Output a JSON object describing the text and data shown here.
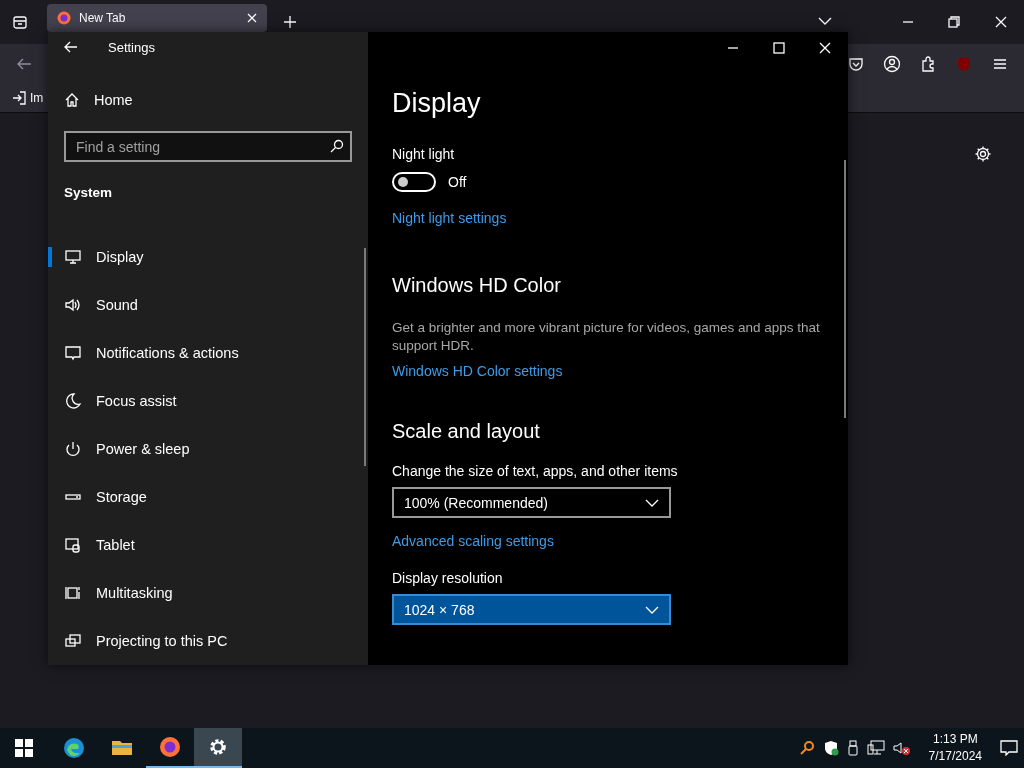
{
  "browser": {
    "tab": {
      "title": "New Tab",
      "selected": true
    },
    "bookmark": "Im"
  },
  "settings": {
    "title": "Settings",
    "home": "Home",
    "search": {
      "placeholder": "Find a setting"
    },
    "group": "System",
    "nav": [
      {
        "label": "Display",
        "kind": "display",
        "selected": true
      },
      {
        "label": "Sound",
        "kind": "sound",
        "selected": false
      },
      {
        "label": "Notifications & actions",
        "kind": "notify",
        "selected": false
      },
      {
        "label": "Focus assist",
        "kind": "moon",
        "selected": false
      },
      {
        "label": "Power & sleep",
        "kind": "power",
        "selected": false
      },
      {
        "label": "Storage",
        "kind": "storage",
        "selected": false
      },
      {
        "label": "Tablet",
        "kind": "tablet",
        "selected": false
      },
      {
        "label": "Multitasking",
        "kind": "multi",
        "selected": false
      },
      {
        "label": "Projecting to this PC",
        "kind": "project",
        "selected": false
      }
    ],
    "page": {
      "title": "Display",
      "night_light": {
        "label": "Night light",
        "on": false,
        "state": "Off",
        "link": "Night light settings"
      },
      "hd_color": {
        "heading": "Windows HD Color",
        "description": "Get a brighter and more vibrant picture for videos, games and apps that support HDR.",
        "link": "Windows HD Color settings"
      },
      "scale": {
        "heading": "Scale and layout",
        "size_label": "Change the size of text, apps, and other items",
        "size_value": "100% (Recommended)",
        "link": "Advanced scaling settings",
        "resolution_label": "Display resolution",
        "resolution_value": "1024 × 768",
        "resolution_focused": true
      }
    }
  },
  "taskbar": {
    "apps": [
      {
        "kind": "edge",
        "running": false,
        "selected": false
      },
      {
        "kind": "folder",
        "running": false,
        "selected": false
      },
      {
        "kind": "firefox",
        "running": true,
        "selected": false
      },
      {
        "kind": "gear",
        "running": true,
        "selected": true
      }
    ],
    "time": "1:13 PM",
    "date": "7/17/2024"
  }
}
